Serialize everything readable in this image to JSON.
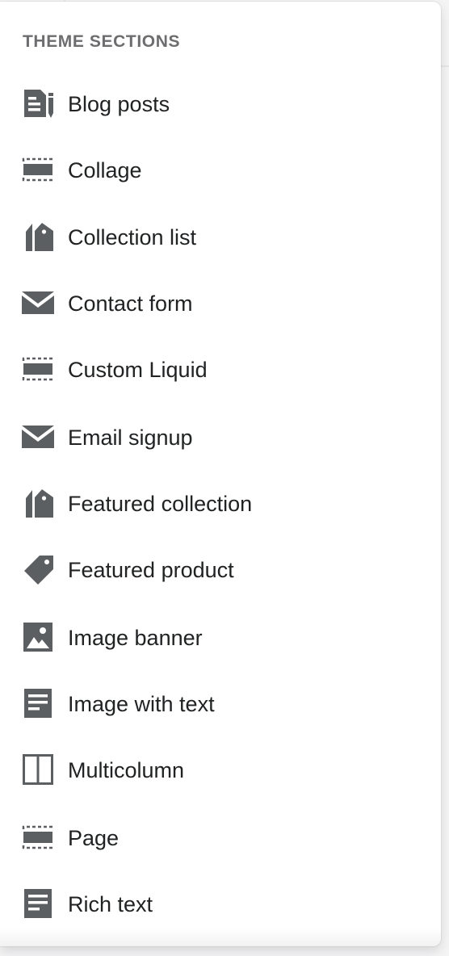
{
  "panel": {
    "title": "THEME SECTIONS",
    "items": [
      {
        "label": "Blog posts",
        "icon": "blog-icon"
      },
      {
        "label": "Collage",
        "icon": "section-placeholder-icon"
      },
      {
        "label": "Collection list",
        "icon": "collection-tags-icon"
      },
      {
        "label": "Contact form",
        "icon": "envelope-icon"
      },
      {
        "label": "Custom Liquid",
        "icon": "section-placeholder-icon"
      },
      {
        "label": "Email signup",
        "icon": "envelope-icon"
      },
      {
        "label": "Featured collection",
        "icon": "collection-tags-icon"
      },
      {
        "label": "Featured product",
        "icon": "tag-icon"
      },
      {
        "label": "Image banner",
        "icon": "image-icon"
      },
      {
        "label": "Image with text",
        "icon": "text-document-icon"
      },
      {
        "label": "Multicolumn",
        "icon": "columns-icon"
      },
      {
        "label": "Page",
        "icon": "section-placeholder-icon"
      },
      {
        "label": "Rich text",
        "icon": "text-document-icon"
      }
    ]
  },
  "colors": {
    "icon": "#5c5f62",
    "text": "#202223",
    "title": "#6d6d70",
    "panel": "#ffffff",
    "backdrop": "#f4f4f5"
  }
}
